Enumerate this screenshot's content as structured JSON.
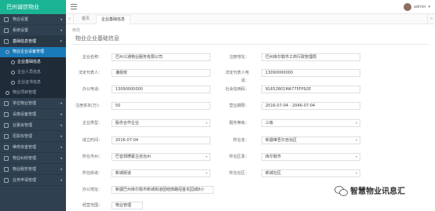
{
  "brand": "巴州诚信物业",
  "sidebar": {
    "items_top": [
      {
        "label": "物业设置"
      },
      {
        "label": "系统设置"
      }
    ],
    "open_group": {
      "label": "基础信息管理",
      "child": {
        "label": "物业企业设备管理",
        "children": [
          {
            "label": "企业基础信息"
          },
          {
            "label": "企业人员信息"
          },
          {
            "label": "企业证书信息"
          }
        ]
      },
      "sibling": {
        "label": "物业项目管理"
      }
    },
    "items_bottom": [
      {
        "label": "单位物业管理"
      },
      {
        "label": "设施设备管理"
      },
      {
        "label": "业委会管理"
      },
      {
        "label": "招投标管理"
      },
      {
        "label": "维修资金管理"
      },
      {
        "label": "物业纠纷管理"
      },
      {
        "label": "物业服务管理"
      },
      {
        "label": "业务申请管理"
      }
    ]
  },
  "topbar": {
    "user_name": "admin"
  },
  "tabs": {
    "home": "首页",
    "active": "企业基础信息"
  },
  "page": {
    "edit_link": "修改",
    "title": "物业企业基础信息"
  },
  "form": {
    "company_name_label": "企业名称：",
    "company_name_value": "巴州义通物业服务有限公司",
    "reg_address_label": "注册地址：",
    "reg_address_value": "巴州库尔勒市工商行政管理局",
    "legal_rep_label": "法定代表人：",
    "legal_rep_value": "潘俊晓",
    "legal_phone_label": "法定代表人电话：",
    "legal_phone_value": "13090000000",
    "office_phone_label": "办公电话：",
    "office_phone_value": "13090000000",
    "credit_code_label": "社会信用码：",
    "credit_code_value": "91652801MA775FP92E",
    "capital_label": "注册资本(万)：",
    "capital_value": "50",
    "business_term_label": "营业期限：",
    "business_term_value": "2016-07-04 - 2046-07-04",
    "company_type_label": "企业类型：",
    "company_type_value": "股份合作企业",
    "qualification_label": "服务等级：",
    "qualification_value": "三级",
    "established_label": "成立时间：",
    "established_value": "2016-07-04",
    "location_label": "所在省：",
    "location_value": "新疆维吾尔自治区",
    "city_label": "所在市州：",
    "city_value": "巴音郭楞蒙古自治州",
    "county_label": "所在区县：",
    "county_value": "库尔勒市",
    "street_label": "所在街道：",
    "street_value": "新城街道",
    "community_label": "所在社区：",
    "community_value": "新城社区",
    "office_address_label": "办公地址：",
    "office_address_value": "新疆巴州库尔勒市新城街道团结南路招金花园城8小",
    "business_scope_label": "经营范围：",
    "business_scope_value": "物业管理"
  },
  "watermark": "智慧物业讯息汇"
}
